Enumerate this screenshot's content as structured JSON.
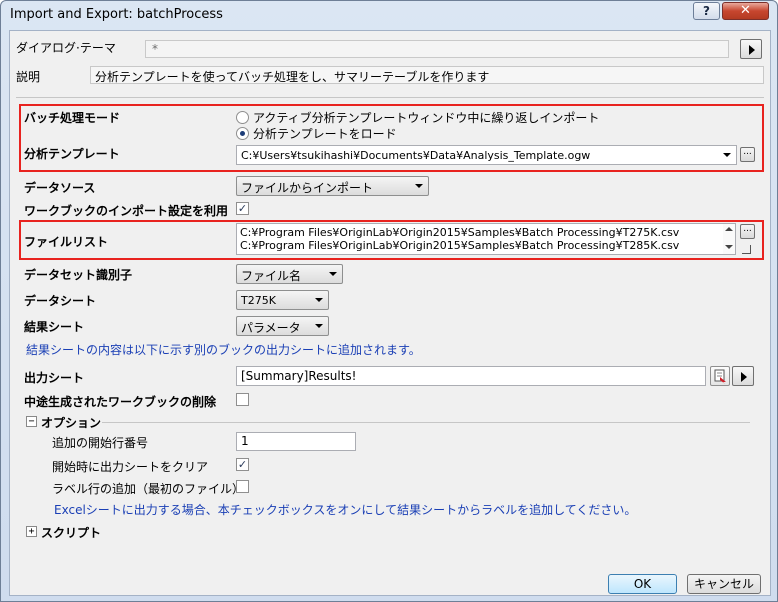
{
  "window": {
    "title": "Import and Export: batchProcess",
    "help_label": "?",
    "close_label": "✕"
  },
  "theme": {
    "label": "ダイアログ·テーマ",
    "value": "*"
  },
  "description": {
    "label": "説明",
    "value": "分析テンプレートを使ってバッチ処理をし、サマリーテーブルを作ります"
  },
  "batch_mode": {
    "label": "バッチ処理モード",
    "options": [
      {
        "label": "アクティブ分析テンプレートウィンドウ中に繰り返しインポート",
        "selected": false
      },
      {
        "label": "分析テンプレートをロード",
        "selected": true
      }
    ]
  },
  "analysis_template": {
    "label": "分析テンプレート",
    "value": "C:¥Users¥tsukihashi¥Documents¥Data¥Analysis_Template.ogw",
    "browse_label": "..."
  },
  "data_source": {
    "label": "データソース",
    "value": "ファイルからインポート"
  },
  "use_workbook_import": {
    "label": "ワークブックのインポート設定を利用",
    "checked": true
  },
  "file_list": {
    "label": "ファイルリスト",
    "files": [
      "C:¥Program Files¥OriginLab¥Origin2015¥Samples¥Batch Processing¥T275K.csv",
      "C:¥Program Files¥OriginLab¥Origin2015¥Samples¥Batch Processing¥T285K.csv"
    ],
    "browse_label": "..."
  },
  "dataset_identifier": {
    "label": "データセット識別子",
    "value": "ファイル名"
  },
  "data_sheet": {
    "label": "データシート",
    "value": "T275K"
  },
  "result_sheet": {
    "label": "結果シート",
    "value": "パラメータ",
    "note": "結果シートの内容は以下に示す別のブックの出力シートに追加されます。"
  },
  "output_sheet": {
    "label": "出力シート",
    "value": "[Summary]Results!"
  },
  "delete_intermediate": {
    "label": "中途生成されたワークブックの削除",
    "checked": false
  },
  "options": {
    "label": "オプション",
    "expander": "−",
    "start_row_label": "追加の開始行番号",
    "start_row_value": "1",
    "clear_output_label": "開始時に出力シートをクリア",
    "clear_output_checked": true,
    "add_label_row_label": "ラベル行の追加（最初のファイル）",
    "add_label_row_checked": false,
    "note": "Excelシートに出力する場合、本チェックボックスをオンにして結果シートからラベルを追加してください。"
  },
  "script": {
    "label": "スクリプト",
    "expander": "+"
  },
  "buttons": {
    "ok": "OK",
    "cancel": "キャンセル"
  },
  "colors": {
    "highlight_border": "#e8231f",
    "info_text": "#1a3fb5"
  }
}
